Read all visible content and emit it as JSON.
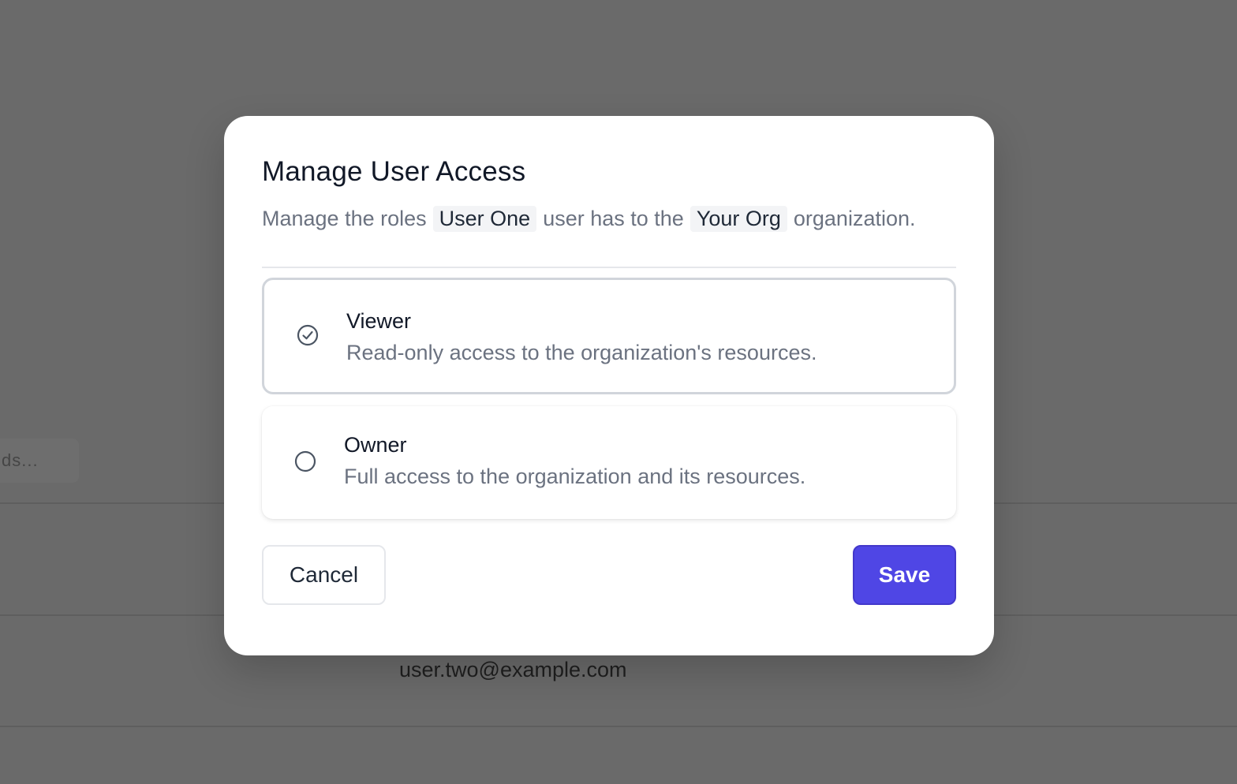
{
  "background": {
    "search_fragment": "ds...",
    "row_email": "user.two@example.com"
  },
  "modal": {
    "title": "Manage User Access",
    "description": {
      "part1": "Manage the roles",
      "user_name": "User One",
      "part2": "user has to the",
      "org_name": "Your Org",
      "part3": "organization."
    },
    "options": [
      {
        "name": "Viewer",
        "description": "Read-only access to the organization's resources.",
        "selected": true,
        "icon": "check-circle-icon"
      },
      {
        "name": "Owner",
        "description": "Full access to the organization and its resources.",
        "selected": false,
        "icon": "empty-circle-icon"
      }
    ],
    "cancel_label": "Cancel",
    "save_label": "Save"
  },
  "colors": {
    "accent": "#4f46e5",
    "overlay": "#6a6a6a"
  }
}
